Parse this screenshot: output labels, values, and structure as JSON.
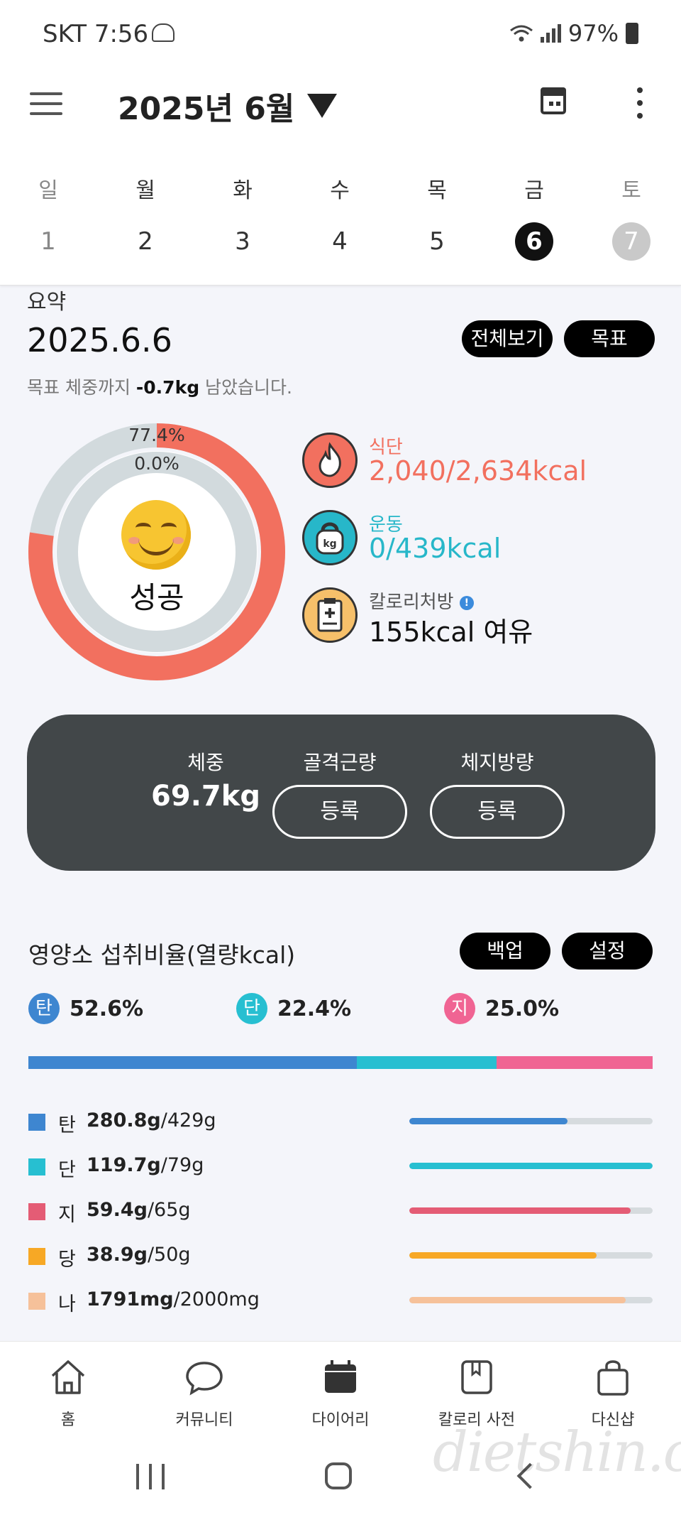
{
  "status_bar": {
    "time": "SKT 7:56",
    "battery": "97%"
  },
  "header": {
    "title": "2025년 6월"
  },
  "week": {
    "days": [
      {
        "name": "일",
        "date": "1"
      },
      {
        "name": "월",
        "date": "2"
      },
      {
        "name": "화",
        "date": "3"
      },
      {
        "name": "수",
        "date": "4"
      },
      {
        "name": "목",
        "date": "5"
      },
      {
        "name": "금",
        "date": "6",
        "selected": true
      },
      {
        "name": "토",
        "date": "7"
      }
    ]
  },
  "summary": {
    "label": "요약",
    "date": "2025.6.6",
    "view_all_label": "전체보기",
    "goal_label": "목표",
    "goal_prefix": "목표 체중까지",
    "goal_value": "-0.7kg",
    "goal_suffix": "남았습니다.",
    "ring_outer_pct": "77.4%",
    "ring_inner_pct": "0.0%",
    "ring_outer_fraction": 0.774,
    "ring_inner_fraction": 0.0,
    "status": "성공",
    "diet": {
      "label": "식단",
      "value": "2,040/2,634kcal",
      "color": "#f2705f"
    },
    "exercise": {
      "label": "운동",
      "value": "0/439kcal",
      "color": "#27b7c9"
    },
    "prescription": {
      "label": "칼로리처방",
      "value": "155kcal 여유",
      "info": "!"
    }
  },
  "body_stats": {
    "weight_label": "체중",
    "weight_value": "69.7kg",
    "muscle_label": "골격근량",
    "muscle_button": "등록",
    "fat_label": "체지방량",
    "fat_button": "등록"
  },
  "nutrition": {
    "title": "영양소 섭취비율(열량kcal)",
    "backup_label": "백업",
    "settings_label": "설정",
    "macros": [
      {
        "badge": "탄",
        "pct": "52.6%",
        "value": 52.6,
        "color": "#3e86d0"
      },
      {
        "badge": "단",
        "pct": "22.4%",
        "value": 22.4,
        "color": "#27bfd1"
      },
      {
        "badge": "지",
        "pct": "25.0%",
        "value": 25.0,
        "color": "#f06493"
      }
    ],
    "rows": [
      {
        "name": "탄",
        "amount": "280.8g",
        "target": "/429g",
        "progress": 0.65,
        "color": "#3e86d0"
      },
      {
        "name": "단",
        "amount": "119.7g",
        "target": "/79g",
        "progress": 1.0,
        "color": "#27bfd1"
      },
      {
        "name": "지",
        "amount": "59.4g",
        "target": "/65g",
        "progress": 0.91,
        "color": "#e45c75"
      },
      {
        "name": "당",
        "amount": "38.9g",
        "target": "/50g",
        "progress": 0.77,
        "color": "#f7a825"
      },
      {
        "name": "나",
        "amount": "1791mg",
        "target": "/2000mg",
        "progress": 0.89,
        "color": "#f6c19a"
      }
    ]
  },
  "bottom_nav": {
    "items": [
      {
        "label": "홈",
        "icon": "home-icon"
      },
      {
        "label": "커뮤니티",
        "icon": "chat-bubble-icon"
      },
      {
        "label": "다이어리",
        "icon": "calendar-icon"
      },
      {
        "label": "칼로리 사전",
        "icon": "book-icon"
      },
      {
        "label": "다신샵",
        "icon": "shopping-bag-icon"
      }
    ]
  },
  "watermark": "dietshin.com"
}
